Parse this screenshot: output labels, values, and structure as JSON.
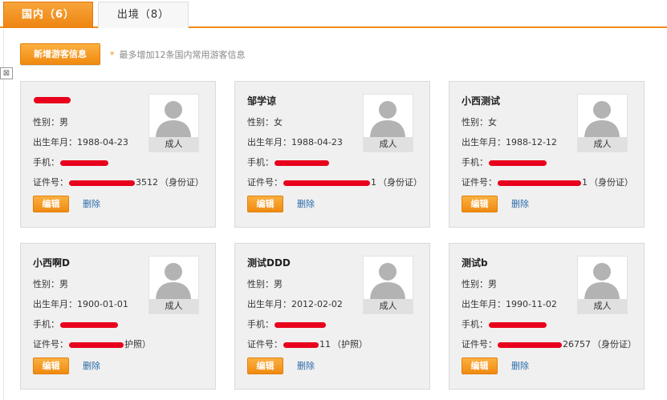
{
  "tabs": [
    {
      "label": "国内（6）",
      "active": true
    },
    {
      "label": "出境（8）",
      "active": false
    }
  ],
  "toolbar": {
    "add_label": "新增游客信息",
    "hint_star": "*",
    "hint_text": "最多增加12条国内常用游客信息",
    "side_icon": "⊠"
  },
  "labels": {
    "gender": "性别：",
    "birth": "出生年月：",
    "phone": "手机：",
    "id": "证件号：",
    "photo": "成人",
    "edit": "编辑",
    "delete": "删除"
  },
  "cards": [
    {
      "name": "",
      "name_redacted": true,
      "gender": "男",
      "birth": "1988-04-23",
      "phone_tail": "",
      "id_tail": "3512",
      "id_type": "（身份证）"
    },
    {
      "name": "邹学谅",
      "name_redacted": false,
      "gender": "女",
      "birth": "1988-04-23",
      "phone_tail": "",
      "id_tail": "1",
      "id_type": "（身份证）"
    },
    {
      "name": "小西测试",
      "name_redacted": false,
      "gender": "女",
      "birth": "1988-12-12",
      "phone_tail": "",
      "id_tail": "1",
      "id_type": "（身份证）"
    },
    {
      "name": "小西啊D",
      "name_redacted": false,
      "gender": "男",
      "birth": "1900-01-01",
      "phone_tail": "",
      "id_tail": "",
      "id_type": "护照）"
    },
    {
      "name": "测试DDD",
      "name_redacted": false,
      "gender": "男",
      "birth": "2012-02-02",
      "phone_tail": "",
      "id_tail": "11",
      "id_type": "（护照）"
    },
    {
      "name": "测试b",
      "name_redacted": false,
      "gender": "男",
      "birth": "1990-11-02",
      "phone_tail": "",
      "id_tail": "26757",
      "id_type": "（身份证）"
    }
  ],
  "colors": {
    "accent": "#f08a10",
    "redaction": "#e8001c",
    "link": "#2a6aa8",
    "card_bg": "#f0f0f0"
  }
}
